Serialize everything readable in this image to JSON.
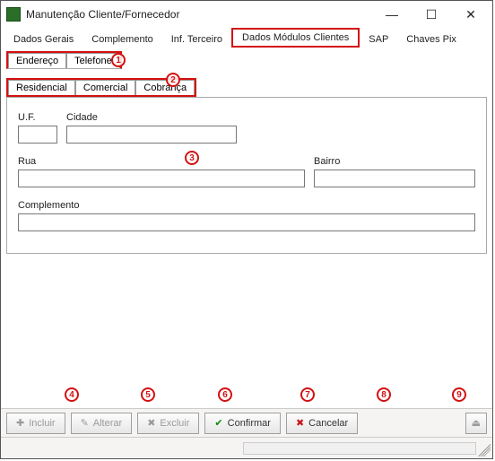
{
  "window": {
    "title": "Manutenção Cliente/Fornecedor"
  },
  "win_controls": {
    "minimize": "—",
    "maximize": "☐",
    "close": "✕"
  },
  "main_tabs": {
    "dados_gerais": "Dados Gerais",
    "complemento": "Complemento",
    "inf_terceiro": "Inf. Terceiro",
    "dados_modulos_clientes": "Dados Módulos Clientes",
    "sap": "SAP",
    "chaves_pix": "Chaves Pix"
  },
  "sub_tabs": {
    "endereco": "Endereço",
    "telefone": "Telefone"
  },
  "sub2_tabs": {
    "residencial": "Residencial",
    "comercial": "Comercial",
    "cobranca": "Cobrança"
  },
  "fields": {
    "uf_label": "U.F.",
    "cidade_label": "Cidade",
    "rua_label": "Rua",
    "bairro_label": "Bairro",
    "complemento_label": "Complemento",
    "uf_value": "",
    "cidade_value": "",
    "rua_value": "",
    "bairro_value": "",
    "complemento_value": ""
  },
  "toolbar": {
    "incluir": "Incluir",
    "alterar": "Alterar",
    "excluir": "Excluir",
    "confirmar": "Confirmar",
    "cancelar": "Cancelar"
  },
  "markers": {
    "m1": "1",
    "m2": "2",
    "m3": "3",
    "m4": "4",
    "m5": "5",
    "m6": "6",
    "m7": "7",
    "m8": "8",
    "m9": "9"
  },
  "colors": {
    "highlight": "#d31111"
  }
}
